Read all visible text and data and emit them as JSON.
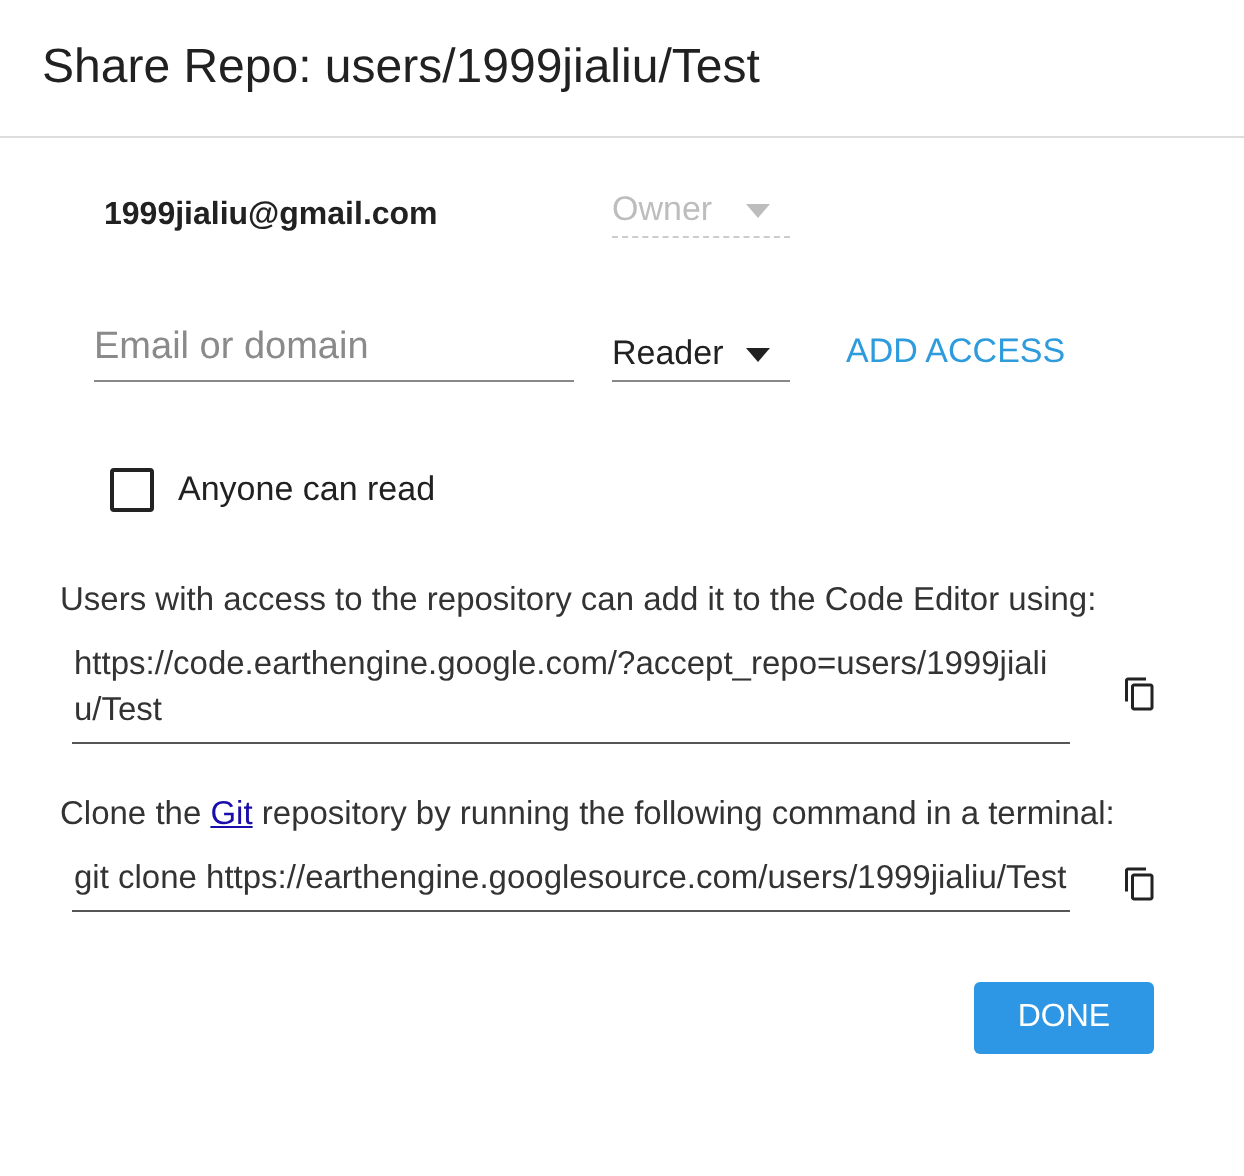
{
  "title": "Share Repo: users/1999jialiu/Test",
  "owner": {
    "email": "1999jialiu@gmail.com",
    "role": "Owner",
    "disabled": true
  },
  "add": {
    "placeholder": "Email or domain",
    "role": "Reader",
    "button": "ADD ACCESS"
  },
  "anyone": {
    "label": "Anyone can read",
    "checked": false
  },
  "sections": [
    {
      "text": "Users with access to the repository can add it to the Code Editor using:",
      "value": "https://code.earthengine.google.com/?accept_repo=users/1999jialiu/Test"
    },
    {
      "text": "Clone the ",
      "link": "Git",
      "after": " repository by running the following command in a terminal:",
      "value": "git clone https://earthengine.googlesource.com/users/1999jialiu/Test"
    }
  ],
  "done": "DONE"
}
